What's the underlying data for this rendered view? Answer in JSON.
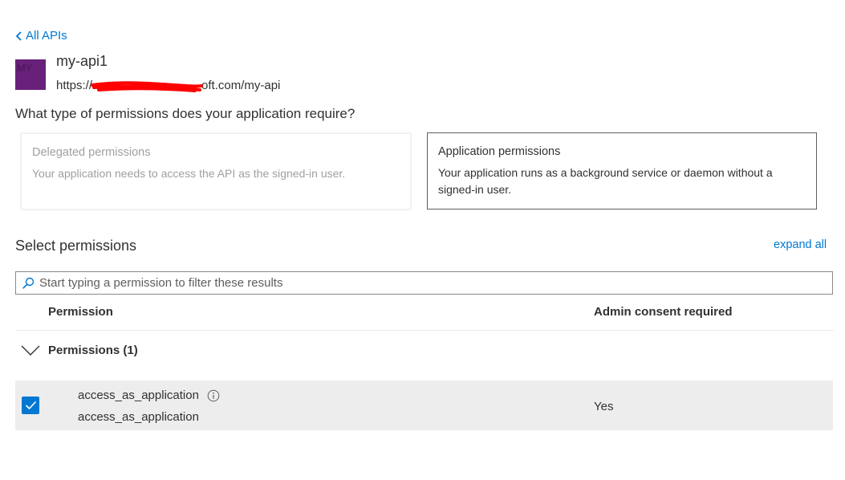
{
  "nav": {
    "back_label": "All APIs"
  },
  "api": {
    "avatar_initials": "MY",
    "name": "my-api1",
    "uri": "https://Shsh3...microsoft.com/my-api",
    "uri_visible_prefix": "https://",
    "uri_visible_suffix": "oft.com/my-api"
  },
  "question": "What type of permissions does your application require?",
  "permission_types": [
    {
      "title": "Delegated permissions",
      "description": "Your application needs to access the API as the signed-in user.",
      "selected": false
    },
    {
      "title": "Application permissions",
      "description": "Your application runs as a background service or daemon without a signed-in user.",
      "selected": true
    }
  ],
  "select_permissions": {
    "title": "Select permissions",
    "expand_all_label": "expand all",
    "search_placeholder": "Start typing a permission to filter these results",
    "columns": {
      "permission": "Permission",
      "admin_consent": "Admin consent required"
    },
    "groups": [
      {
        "label": "Permissions (1)",
        "expanded": true,
        "items": [
          {
            "name": "access_as_application",
            "description": "access_as_application",
            "admin_consent": "Yes",
            "checked": true
          }
        ]
      }
    ]
  },
  "colors": {
    "accent": "#0078d4",
    "avatar_bg": "#68217a",
    "row_selected_bg": "#ededed",
    "redaction": "#ff0000"
  },
  "icons": {
    "back": "chevron-left-icon",
    "search": "search-icon",
    "collapse": "chevron-down-icon",
    "check": "checkmark-icon",
    "info": "info-icon"
  }
}
